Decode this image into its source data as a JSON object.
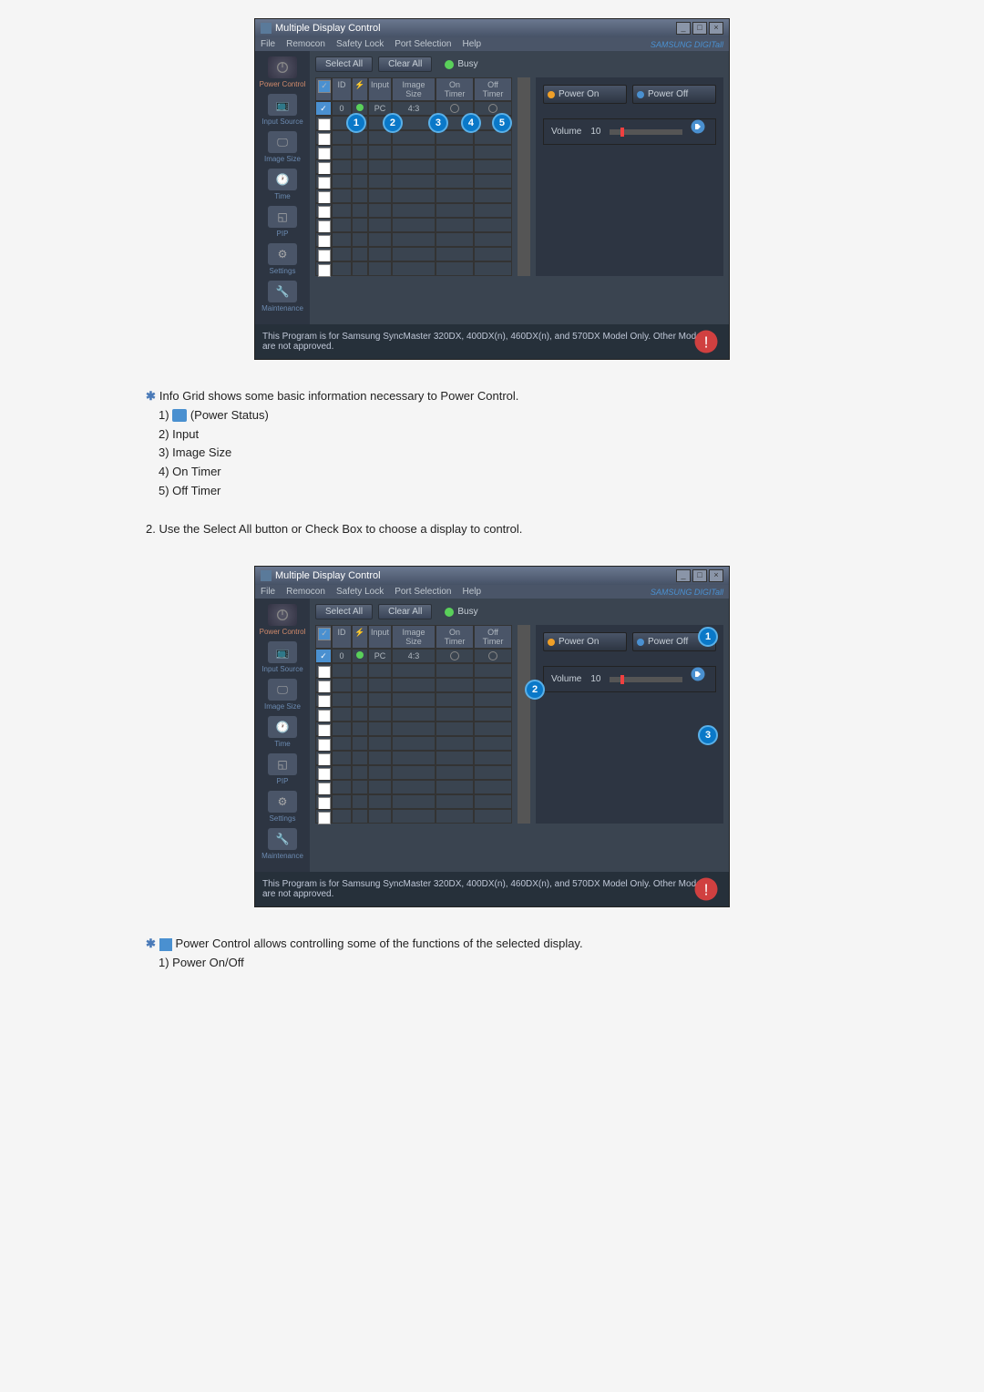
{
  "window_title": "Multiple Display Control",
  "menubar": [
    "File",
    "Remocon",
    "Safety Lock",
    "Port Selection",
    "Help"
  ],
  "brand": "SAMSUNG DIGITall",
  "sidebar": {
    "power_control": "Power Control",
    "input_source": "Input Source",
    "image_size": "Image Size",
    "time": "Time",
    "pip": "PIP",
    "settings": "Settings",
    "maintenance": "Maintenance"
  },
  "toolbar": {
    "select_all": "Select All",
    "clear_all": "Clear All",
    "busy": "Busy"
  },
  "grid": {
    "headers": {
      "id": "ID",
      "input": "Input",
      "image_size": "Image Size",
      "on_timer": "On Timer",
      "off_timer": "Off Timer"
    },
    "row1": {
      "id": "0",
      "input": "PC",
      "size": "4:3"
    }
  },
  "panel": {
    "power_on": "Power On",
    "power_off": "Power Off",
    "volume": "Volume",
    "volume_val": "10"
  },
  "footer": "This Program is for Samsung SyncMaster 320DX, 400DX(n), 460DX(n), and 570DX  Model Only. Other Models are not approved.",
  "desc1": {
    "intro": "Info Grid shows some basic information necessary to Power Control.",
    "items": [
      "1)",
      "(Power Status)",
      "2) Input",
      "3) Image Size",
      "4) On Timer",
      "5) Off Timer"
    ],
    "line2": "2.  Use the Select All button or Check Box to choose a display to control."
  },
  "desc2": {
    "intro": "Power Control allows controlling some of the functions of the selected display.",
    "item1": "1)  Power On/Off"
  }
}
